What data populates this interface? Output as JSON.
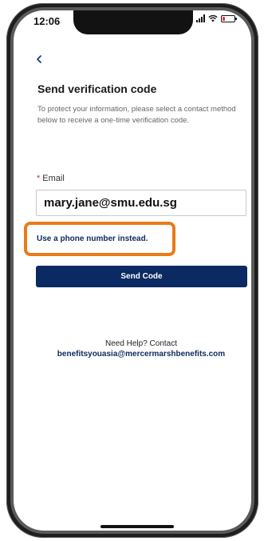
{
  "status_bar": {
    "time": "12:06"
  },
  "header": {
    "title": "Send verification code"
  },
  "description": "To protect your information, please select a contact method below to receive a one-time verification code.",
  "email_field": {
    "required_marker": "*",
    "label": "Email",
    "value": "mary.jane@smu.edu.sg"
  },
  "alternate_link": "Use a phone number instead.",
  "send_button_label": "Send Code",
  "help": {
    "text": "Need Help? Contact",
    "email": "benefitsyouasia@mercermarshbenefits.com"
  },
  "colors": {
    "primary": "#0b2a63",
    "highlight": "#ea7a18",
    "required": "#d32f2f"
  }
}
